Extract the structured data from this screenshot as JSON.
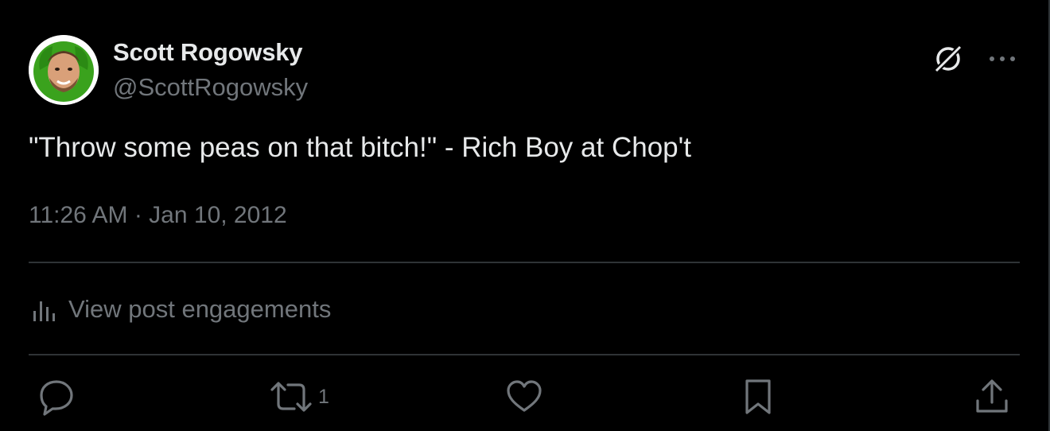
{
  "author": {
    "display_name": "Scott Rogowsky",
    "handle": "@ScottRogowsky",
    "avatar_icon": "profile-photo-avatar"
  },
  "header_actions": {
    "grok_icon": "grok-icon",
    "more_icon": "more-dots-icon"
  },
  "tweet": {
    "text": "\"Throw some peas on that bitch!\" - Rich Boy at Chop't",
    "timestamp": "11:26 AM · Jan 10, 2012"
  },
  "engagements": {
    "icon": "analytics-bars-icon",
    "label": "View post engagements"
  },
  "actions": {
    "reply": {
      "icon": "reply-bubble-icon"
    },
    "retweet": {
      "icon": "retweet-icon",
      "count": "1"
    },
    "like": {
      "icon": "heart-icon"
    },
    "bookmark": {
      "icon": "bookmark-icon"
    },
    "share": {
      "icon": "share-upload-icon"
    }
  },
  "colors": {
    "background": "#000000",
    "primary_text": "#e7e9ea",
    "secondary_text": "#71767b",
    "divider": "#2f3336"
  }
}
